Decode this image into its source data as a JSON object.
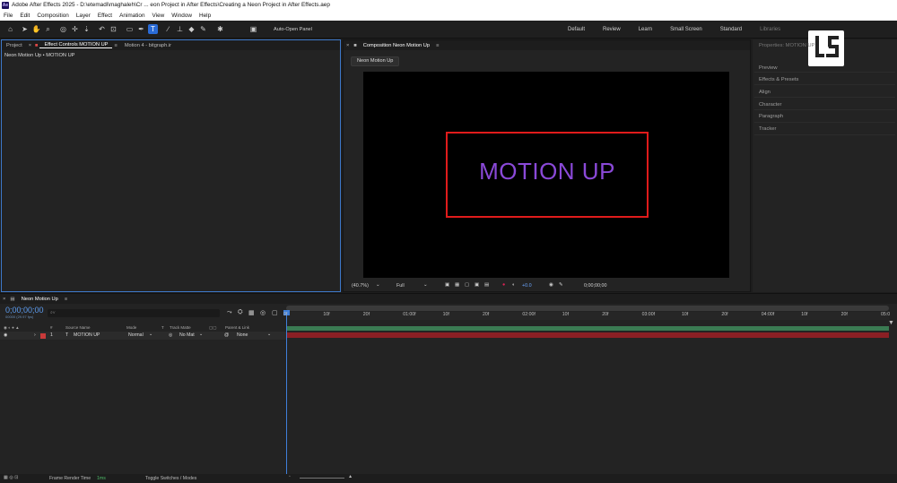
{
  "titlebar": {
    "app_icon": "Ae",
    "title": "Adobe After Effects 2025 - D:\\etemadi\\maghaleh\\Cr ... eon Project in After Effects\\Creating a Neon Project in After Effects.aep"
  },
  "menubar": [
    "File",
    "Edit",
    "Composition",
    "Layer",
    "Effect",
    "Animation",
    "View",
    "Window",
    "Help"
  ],
  "toolbar": {
    "auto_open_label": "Auto-Open Panel",
    "auto_open_checked": true,
    "workspaces": [
      "Default",
      "Review",
      "Learn",
      "Small Screen",
      "Standard",
      "Libraries"
    ]
  },
  "left_panel": {
    "tabs": [
      "Project",
      "Effect Controls MOTION UP",
      "Motion 4 - bitgraph.ir"
    ],
    "header": "Neon Motion Up • MOTION UP"
  },
  "comp_panel": {
    "tab": "Composition Neon Motion Up",
    "subtab": "Neon Motion Up",
    "canvas_text": "MOTION UP",
    "zoom": "(40.7%)",
    "resolution": "Full",
    "exposure": "+0.0",
    "timecode": "0;00;00;00",
    "text_color": "#8a49d8",
    "box_color": "#e01b1b"
  },
  "props_panel": {
    "items": [
      "Properties: MOTION UP",
      "Preview",
      "Effects & Presets",
      "Align",
      "Character",
      "Paragraph",
      "Tracker"
    ]
  },
  "timeline": {
    "tab": "Neon Motion Up",
    "current_time": "0;00;00;00",
    "frame_info": "00000 (29.97 fps)",
    "search_placeholder": "⌕∨",
    "columns": {
      "source_name": "Source Name",
      "mode": "Mode",
      "t": "T",
      "track_matte": "Track Matte",
      "parent": "Parent & Link"
    },
    "layer": {
      "number": "1",
      "type_icon": "T",
      "name": "MOTION UP",
      "mode": "Normal",
      "matte": "No Mat",
      "parent": "None"
    },
    "ruler": [
      "0f",
      "10f",
      "20f",
      "01:00f",
      "10f",
      "20f",
      "02:00f",
      "10f",
      "20f",
      "03:00f",
      "10f",
      "20f",
      "04:00f",
      "10f",
      "20f",
      "05:0"
    ],
    "footer": {
      "render_label": "Frame Render Time",
      "render_value": "1ms",
      "toggle": "Toggle Switches / Modes"
    }
  }
}
